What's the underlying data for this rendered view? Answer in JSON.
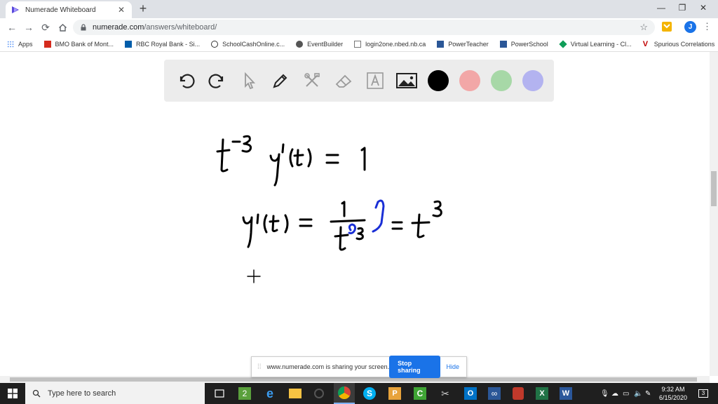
{
  "browser": {
    "tab_title": "Numerade Whiteboard",
    "url_host": "numerade.com",
    "url_path": "/answers/whiteboard/",
    "profile_initial": "J"
  },
  "bookmarks": [
    {
      "label": "Apps",
      "icon": "apps-grid-icon",
      "color": "#4285f4"
    },
    {
      "label": "BMO Bank of Mont...",
      "icon": "bmo-icon",
      "color": "#d52b1e"
    },
    {
      "label": "RBC Royal Bank - Si...",
      "icon": "rbc-icon",
      "color": "#005daa"
    },
    {
      "label": "SchoolCashOnline.c...",
      "icon": "schoolcash-icon",
      "color": "#333333"
    },
    {
      "label": "EventBuilder",
      "icon": "eventbuilder-icon",
      "color": "#555555"
    },
    {
      "label": "login2one.nbed.nb.ca",
      "icon": "page-icon",
      "color": "#777777"
    },
    {
      "label": "PowerTeacher",
      "icon": "powerteacher-icon",
      "color": "#2b5797"
    },
    {
      "label": "PowerSchool",
      "icon": "powerschool-icon",
      "color": "#2b5797"
    },
    {
      "label": "Virtual Learning - Cl...",
      "icon": "virtual-learning-icon",
      "color": "#0f9d58"
    },
    {
      "label": "Spurious Correlations",
      "icon": "spurious-icon",
      "color": "#c00000"
    }
  ],
  "whiteboard": {
    "colors": [
      "#000000",
      "#f2a7a7",
      "#a7d8a7",
      "#b3b3f0"
    ],
    "ink_black": "#000000",
    "ink_blue": "#1a2fd6"
  },
  "share_banner": {
    "message": "www.numerade.com is sharing your screen.",
    "stop_label": "Stop sharing",
    "hide_label": "Hide"
  },
  "taskbar": {
    "search_placeholder": "Type here to search",
    "time": "9:32 AM",
    "date": "6/15/2020",
    "notification_count": "3"
  }
}
